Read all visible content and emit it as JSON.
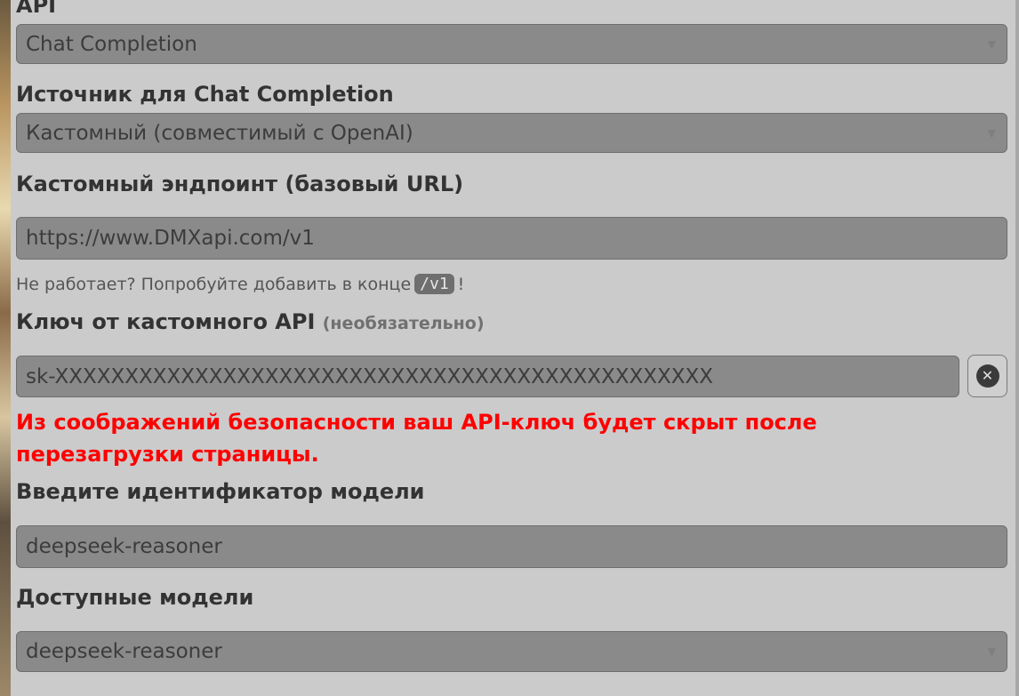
{
  "api": {
    "label": "API",
    "selected": "Chat Completion"
  },
  "source": {
    "label": "Источник для Chat Completion",
    "selected": "Кастомный (совместимый с OpenAI)"
  },
  "endpoint": {
    "label": "Кастомный эндпоинт (базовый URL)",
    "value": "https://www.DMXapi.com/v1",
    "hint_before": "Не работает? Попробуйте добавить в конце",
    "hint_code": "/v1",
    "hint_after": "!"
  },
  "api_key": {
    "label": "Ключ от кастомного API",
    "optional_note": "(необязательно)",
    "value": "sk-XXXXXXXXXXXXXXXXXXXXXXXXXXXXXXXXXXXXXXXXXXXXXXX",
    "clear_icon": "close-circle-icon"
  },
  "security_warning": "Из соображений безопасности ваш API-ключ будет скрыт после перезагрузки страницы.",
  "model_id": {
    "label": "Введите идентификатор модели",
    "value": "deepseek-reasoner"
  },
  "available_models": {
    "label": "Доступные модели",
    "selected": "deepseek-reasoner"
  },
  "colors": {
    "panel_bg": "#cbcbcb",
    "field_bg": "#8a8a8a",
    "warning": "#ff0000",
    "label_text": "#333333"
  }
}
